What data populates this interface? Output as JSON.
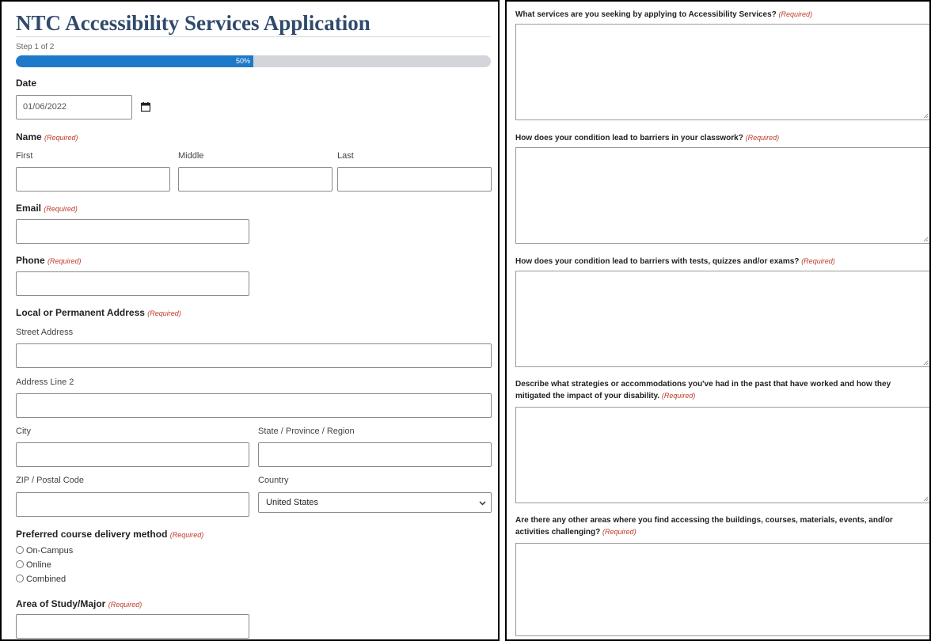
{
  "form": {
    "title": "NTC Accessibility Services Application",
    "step_text": "Step 1 of 2",
    "progress": {
      "percent": 50,
      "label": "50%"
    },
    "required_text": "(Required)",
    "date": {
      "label": "Date",
      "value": "01/06/2022"
    },
    "name": {
      "label": "Name",
      "first": "First",
      "middle": "Middle",
      "last": "Last"
    },
    "email": {
      "label": "Email"
    },
    "phone": {
      "label": "Phone"
    },
    "address": {
      "label": "Local or Permanent Address",
      "street": "Street Address",
      "line2": "Address Line 2",
      "city": "City",
      "state": "State / Province / Region",
      "zip": "ZIP / Postal Code",
      "country_label": "Country",
      "country_value": "United States"
    },
    "delivery": {
      "label": "Preferred course delivery method",
      "options": [
        "On-Campus",
        "Online",
        "Combined"
      ]
    },
    "major": {
      "label": "Area of Study/Major"
    }
  },
  "questions": [
    "What services are you seeking by applying to Accessibility Services?",
    "How does your condition lead to barriers in your classwork?",
    "How does your condition lead to barriers with tests, quizzes and/or exams?",
    "Describe what strategies or accommodations you've had in the past that have worked and how they mitigated the impact of your disability.",
    "Are there any other areas where you find accessing the buildings, courses, materials, events, and/or activities challenging?"
  ],
  "colors": {
    "title": "#2f4a6b",
    "progress_fill": "#1d79c9",
    "progress_track": "#d3d5db",
    "required": "#c0392b"
  }
}
